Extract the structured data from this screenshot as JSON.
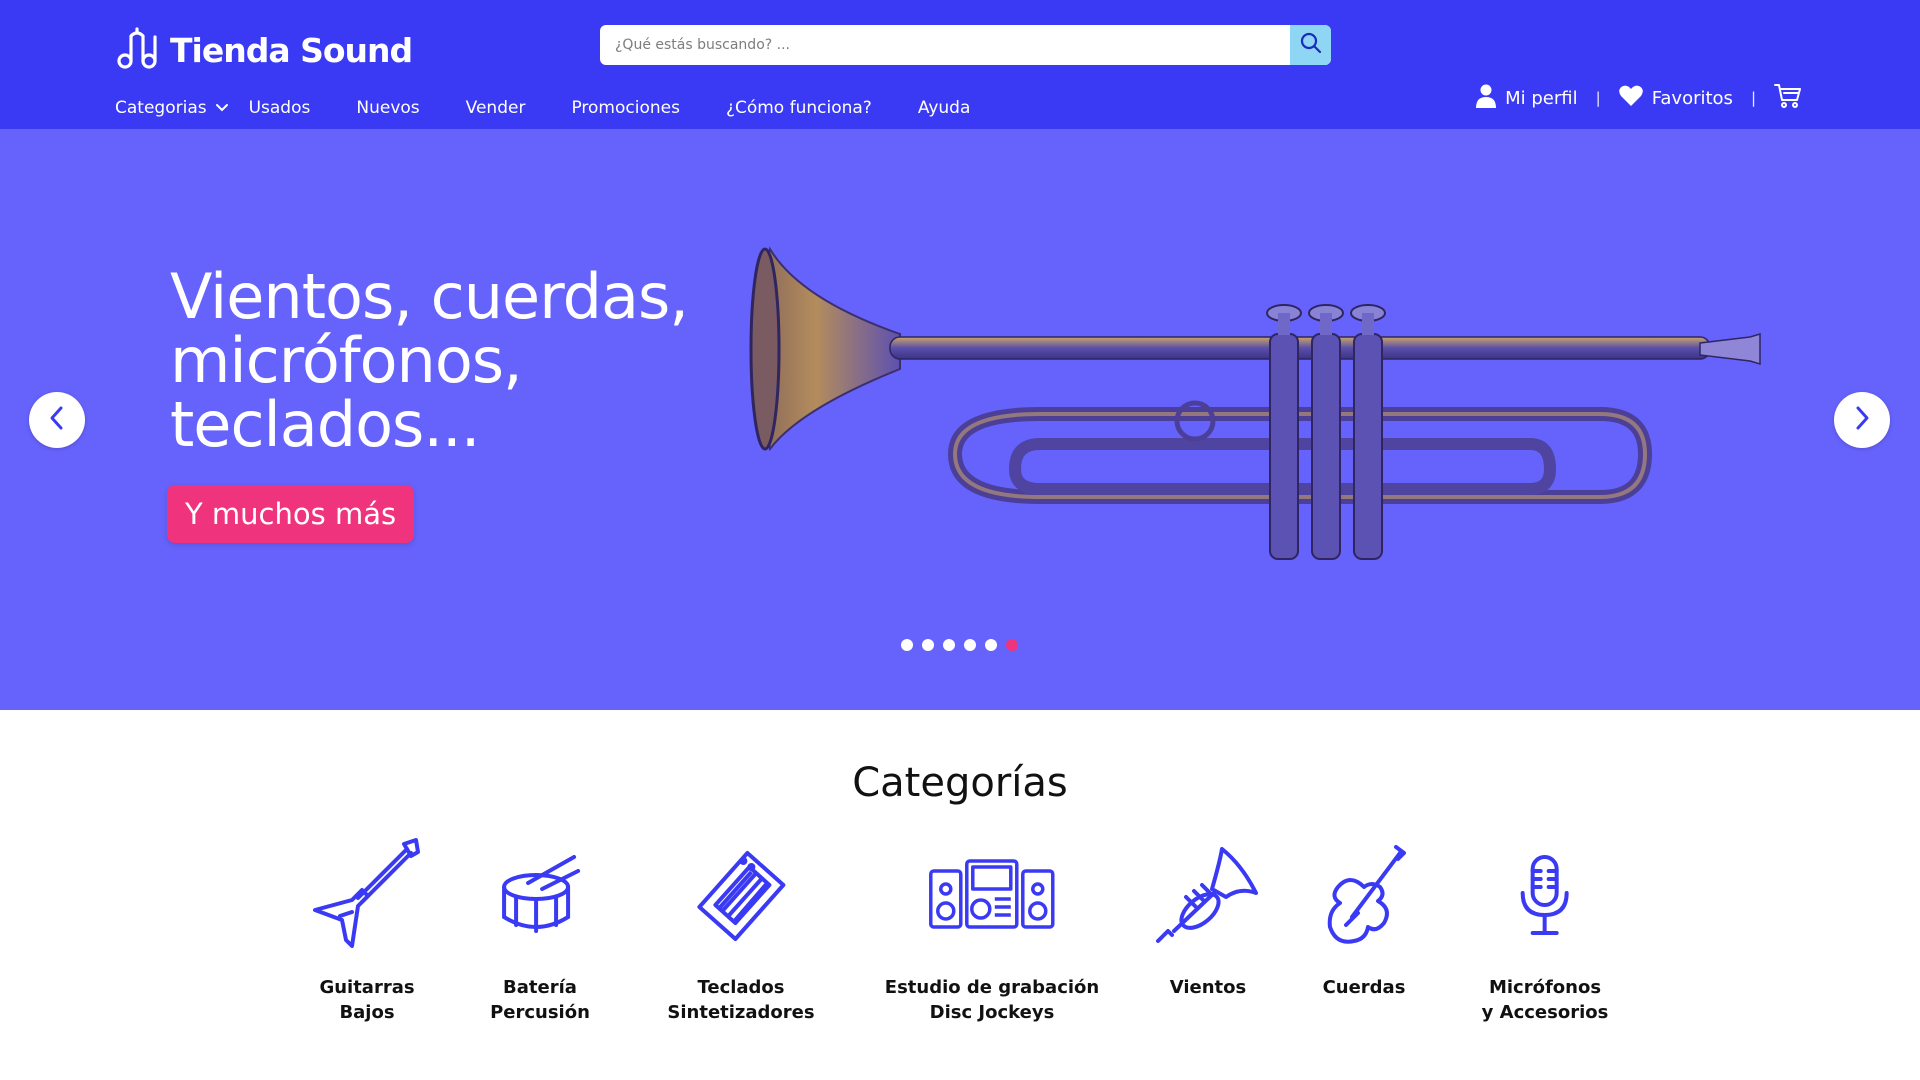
{
  "header": {
    "logo_text": "Tienda Sound",
    "search_placeholder": "¿Qué estás buscando? ...",
    "nav": [
      {
        "label": "Categorias"
      },
      {
        "label": "Usados"
      },
      {
        "label": "Nuevos"
      },
      {
        "label": "Vender"
      },
      {
        "label": "Promociones"
      },
      {
        "label": "¿Cómo funciona?"
      },
      {
        "label": "Ayuda"
      }
    ],
    "profile_label": "Mi perfil",
    "favorites_label": "Favoritos",
    "separator": "|"
  },
  "hero": {
    "title_lines": [
      "Vientos, cuerdas,",
      "micrófonos,",
      "teclados..."
    ],
    "cta_label": "Y muchos más",
    "slide_count": 6,
    "active_slide": 6
  },
  "categories": {
    "title": "Categorías",
    "items": [
      {
        "line1": "Guitarras",
        "line2": "Bajos",
        "icon": "guitar-icon"
      },
      {
        "line1": "Batería",
        "line2": "Percusión",
        "icon": "drum-icon"
      },
      {
        "line1": "Teclados",
        "line2": "Sintetizadores",
        "icon": "keyboard-icon"
      },
      {
        "line1": "Estudio de grabación",
        "line2": "Disc Jockeys",
        "icon": "studio-icon"
      },
      {
        "line1": "Vientos",
        "line2": "",
        "icon": "trumpet-icon"
      },
      {
        "line1": "Cuerdas",
        "line2": "",
        "icon": "violin-icon"
      },
      {
        "line1": "Micrófonos",
        "line2": "y Accesorios",
        "icon": "microphone-icon"
      }
    ]
  },
  "colors": {
    "header_bg": "#3a3af4",
    "hero_bg": "#6663fd",
    "accent_pink": "#f0337d",
    "search_button": "#8fd6f4",
    "icon_blue": "#3a3af4"
  }
}
